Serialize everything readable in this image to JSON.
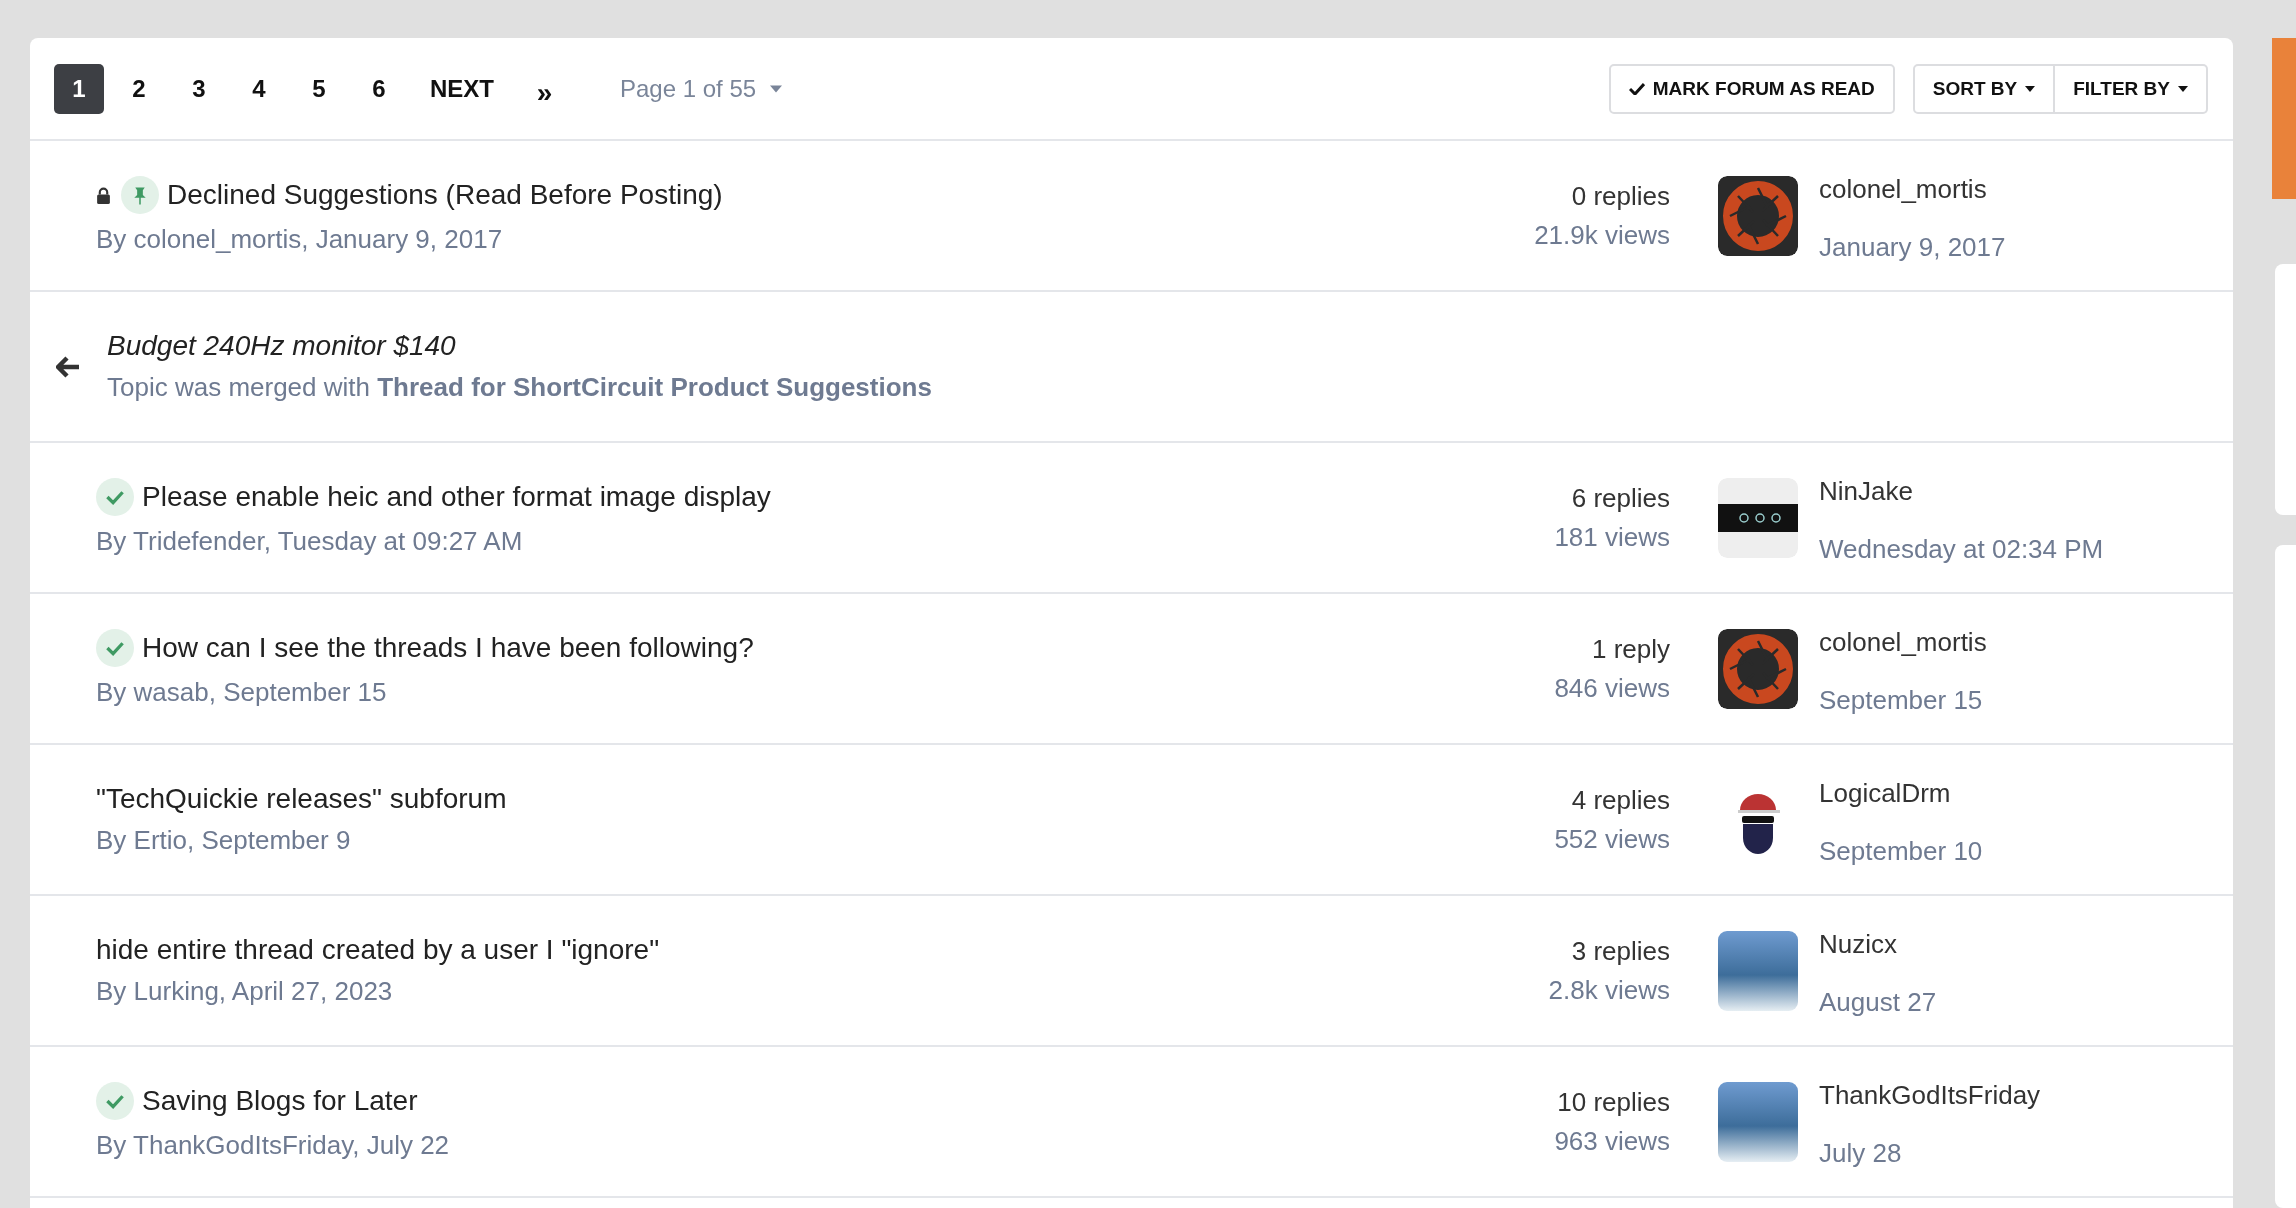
{
  "pagination": {
    "pages": [
      {
        "label": "1",
        "selected": true
      },
      {
        "label": "2",
        "selected": false
      },
      {
        "label": "3",
        "selected": false
      },
      {
        "label": "4",
        "selected": false
      },
      {
        "label": "5",
        "selected": false
      },
      {
        "label": "6",
        "selected": false
      }
    ],
    "next": "NEXT",
    "last": "»",
    "page_info": "Page 1 of 55"
  },
  "actions": {
    "mark_read": "MARK FORUM AS READ",
    "sort": "SORT BY",
    "filter": "FILTER BY"
  },
  "topics": [
    {
      "kind": "topic",
      "title": "Declined Suggestions (Read Before Posting)",
      "meta": "By colonel_mortis, January 9, 2017",
      "locked": true,
      "pinned": true,
      "solved": false,
      "replies": "0 replies",
      "views": "21.9k views",
      "last_poster": "colonel_mortis",
      "last_date": "January 9, 2017",
      "avatar": {
        "kind": "aperture"
      }
    },
    {
      "kind": "merged",
      "title": "Budget 240Hz monitor $140",
      "notice": "Topic was merged with",
      "link": "Thread for ShortCircuit Product Suggestions"
    },
    {
      "kind": "topic",
      "title": "Please enable heic and other format image display",
      "meta": "By Tridefender, Tuesday at 09:27 AM",
      "locked": false,
      "pinned": false,
      "solved": true,
      "replies": "6 replies",
      "views": "181 views",
      "last_poster": "NinJake",
      "last_date": "Wednesday at 02:34 PM",
      "avatar": {
        "kind": "banner"
      }
    },
    {
      "kind": "topic",
      "title": "How can I see the threads I have been following?",
      "meta": "By wasab, September 15",
      "locked": false,
      "pinned": false,
      "solved": true,
      "replies": "1 reply",
      "views": "846 views",
      "last_poster": "colonel_mortis",
      "last_date": "September 15",
      "avatar": {
        "kind": "aperture"
      }
    },
    {
      "kind": "topic",
      "title": "\"TechQuickie releases\" subforum",
      "meta": "By Ertio, September 9",
      "locked": false,
      "pinned": false,
      "solved": false,
      "replies": "4 replies",
      "views": "552 views",
      "last_poster": "LogicalDrm",
      "last_date": "September 10",
      "avatar": {
        "kind": "masked"
      }
    },
    {
      "kind": "topic",
      "title": "hide entire thread created by a user I \"ignore\"",
      "meta": "By Lurking, April 27, 2023",
      "locked": false,
      "pinned": false,
      "solved": false,
      "replies": "3 replies",
      "views": "2.8k views",
      "last_poster": "Nuzicx",
      "last_date": "August 27",
      "avatar": {
        "kind": "photo"
      }
    },
    {
      "kind": "topic",
      "title": "Saving Blogs for Later",
      "meta": "By ThankGodItsFriday, July 22",
      "locked": false,
      "pinned": false,
      "solved": true,
      "replies": "10 replies",
      "views": "963 views",
      "last_poster": "ThankGodItsFriday",
      "last_date": "July 28",
      "avatar": {
        "kind": "photo"
      }
    }
  ]
}
